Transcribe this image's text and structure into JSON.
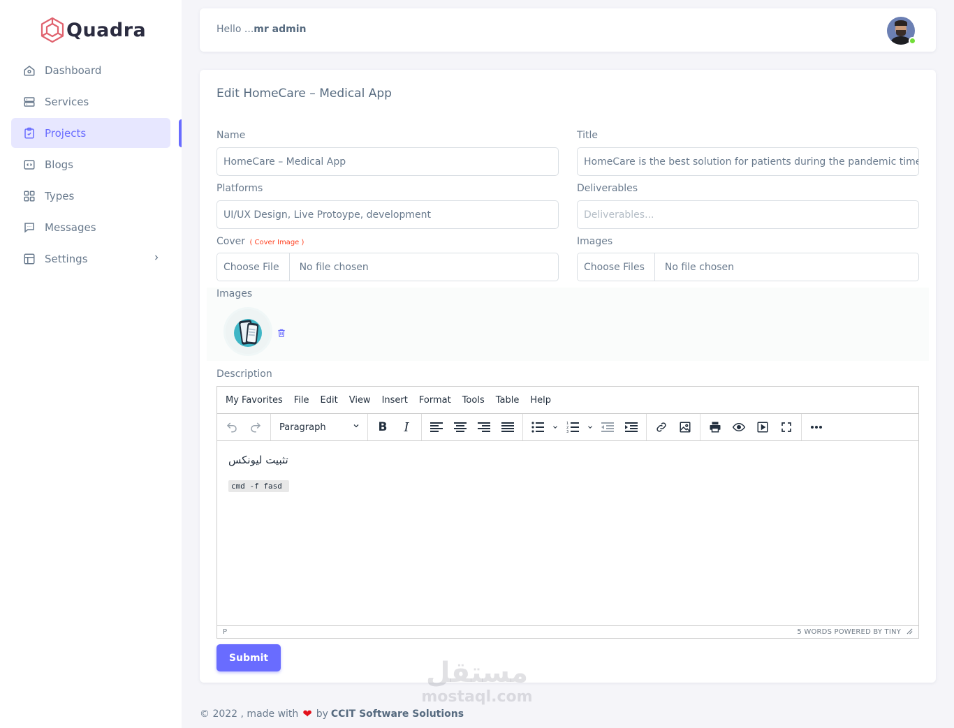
{
  "brand": {
    "name": "Quadra"
  },
  "sidebar": {
    "items": [
      {
        "label": "Dashboard",
        "icon": "home-icon",
        "active": false
      },
      {
        "label": "Services",
        "icon": "server-icon",
        "active": false
      },
      {
        "label": "Projects",
        "icon": "clipboard-check-icon",
        "active": true
      },
      {
        "label": "Blogs",
        "icon": "code-window-icon",
        "active": false
      },
      {
        "label": "Types",
        "icon": "grid-icon",
        "active": false
      },
      {
        "label": "Messages",
        "icon": "chat-icon",
        "active": false
      },
      {
        "label": "Settings",
        "icon": "layout-icon",
        "active": false,
        "has_submenu": true
      }
    ]
  },
  "navbar": {
    "greeting": "Hello ...",
    "user": "mr admin"
  },
  "form": {
    "title": "Edit HomeCare – Medical App",
    "name_label": "Name",
    "name_value": "HomeCare – Medical App",
    "title_label": "Title",
    "title_value": "HomeCare is the best solution for patients during the pandemic time",
    "platforms_label": "Platforms",
    "platforms_value": "UI/UX Design, Live Protoype, development",
    "deliverables_label": "Deliverables",
    "deliverables_placeholder": "Deliverables...",
    "cover_label": "Cover",
    "cover_hint": "( Cover Image )",
    "cover_button": "Choose File",
    "cover_status": "No file chosen",
    "images_label": "Images",
    "images_button": "Choose Files",
    "images_status": "No file chosen",
    "gallery_label": "Images",
    "description_label": "Description",
    "submit_label": "Submit"
  },
  "editor": {
    "menus": [
      "My Favorites",
      "File",
      "Edit",
      "View",
      "Insert",
      "Format",
      "Tools",
      "Table",
      "Help"
    ],
    "block_format": "Paragraph",
    "content_text": "تثبيت ليونكس",
    "content_code": "cmd -f fasd",
    "status_path": "P",
    "status_right": "5 WORDS  POWERED BY TINY"
  },
  "watermark": {
    "arabic": "مستقل",
    "latin": "mostaql.com"
  },
  "footer": {
    "prefix": "© 2022 , made with",
    "by": "by",
    "company": "CCIT Software Solutions"
  },
  "colors": {
    "accent": "#696cff",
    "active_bg": "#e7e7ff",
    "heart": "#e3101b",
    "online": "#71dd37"
  }
}
